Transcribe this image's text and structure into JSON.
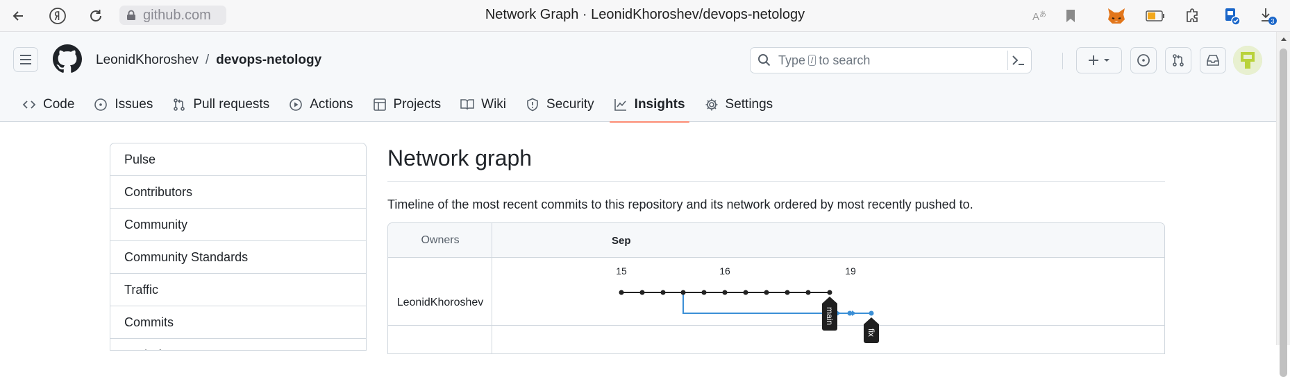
{
  "browser": {
    "url": "github.com",
    "window_title": "Network Graph · LeonidKhoroshev/devops-netology",
    "download_badge": "3"
  },
  "header": {
    "owner": "LeonidKhoroshev",
    "separator": "/",
    "repo": "devops-netology",
    "search_placeholder_pre": "Type",
    "search_kbd": "/",
    "search_placeholder_post": "to search"
  },
  "tabs": [
    {
      "label": "Code",
      "icon": "code-icon"
    },
    {
      "label": "Issues",
      "icon": "issue-icon"
    },
    {
      "label": "Pull requests",
      "icon": "pull-request-icon"
    },
    {
      "label": "Actions",
      "icon": "play-icon"
    },
    {
      "label": "Projects",
      "icon": "table-icon"
    },
    {
      "label": "Wiki",
      "icon": "book-icon"
    },
    {
      "label": "Security",
      "icon": "shield-icon"
    },
    {
      "label": "Insights",
      "icon": "graph-icon",
      "active": true
    },
    {
      "label": "Settings",
      "icon": "gear-icon"
    }
  ],
  "sidebar": {
    "items": [
      "Pulse",
      "Contributors",
      "Community",
      "Community Standards",
      "Traffic",
      "Commits",
      "Code frequency"
    ]
  },
  "main": {
    "title": "Network graph",
    "description": "Timeline of the most recent commits to this repository and its network ordered by most recently pushed to."
  },
  "network": {
    "owners_header": "Owners",
    "month": "Sep",
    "dates": [
      "15",
      "16",
      "19"
    ],
    "owner": "LeonidKhoroshev",
    "branches": [
      "main",
      "fix"
    ],
    "colors": {
      "main_line": "#222222",
      "branch_line": "#3b8fd6",
      "tag_bg": "#1f1f1f"
    }
  }
}
